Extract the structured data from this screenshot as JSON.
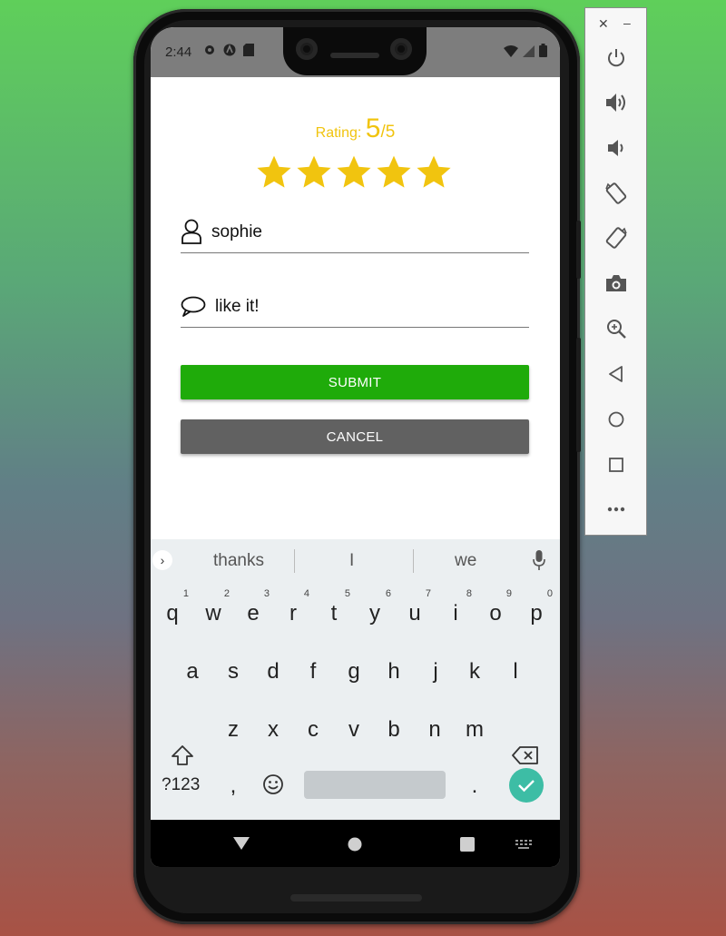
{
  "status_bar": {
    "time": "2:44"
  },
  "rating": {
    "label": "Rating:",
    "value": "5",
    "max": "/5",
    "stars_filled": 5,
    "stars_total": 5,
    "color": "#f1c40f"
  },
  "form": {
    "name_value": "sophie",
    "comment_value": "like it!",
    "name_icon": "user-icon",
    "comment_icon": "comment-bubble-icon"
  },
  "buttons": {
    "submit_label": "SUBMIT",
    "cancel_label": "CANCEL",
    "submit_color": "#1fab0a",
    "cancel_color": "#616161"
  },
  "keyboard": {
    "suggestions": [
      "thanks",
      "I",
      "we"
    ],
    "row1": [
      {
        "k": "q",
        "n": "1"
      },
      {
        "k": "w",
        "n": "2"
      },
      {
        "k": "e",
        "n": "3"
      },
      {
        "k": "r",
        "n": "4"
      },
      {
        "k": "t",
        "n": "5"
      },
      {
        "k": "y",
        "n": "6"
      },
      {
        "k": "u",
        "n": "7"
      },
      {
        "k": "i",
        "n": "8"
      },
      {
        "k": "o",
        "n": "9"
      },
      {
        "k": "p",
        "n": "0"
      }
    ],
    "row2": [
      "a",
      "s",
      "d",
      "f",
      "g",
      "h",
      "j",
      "k",
      "l"
    ],
    "row3": [
      "z",
      "x",
      "c",
      "v",
      "b",
      "n",
      "m"
    ],
    "symbols_key": "?123",
    "comma_key": ",",
    "period_key": "."
  },
  "emulator_panel": {
    "close_label": "✕",
    "minimize_label": "–",
    "controls": [
      "power-icon",
      "volume-up-icon",
      "volume-down-icon",
      "rotate-left-icon",
      "rotate-right-icon",
      "camera-icon",
      "zoom-icon",
      "back-icon",
      "home-icon",
      "overview-icon",
      "more-icon"
    ]
  }
}
